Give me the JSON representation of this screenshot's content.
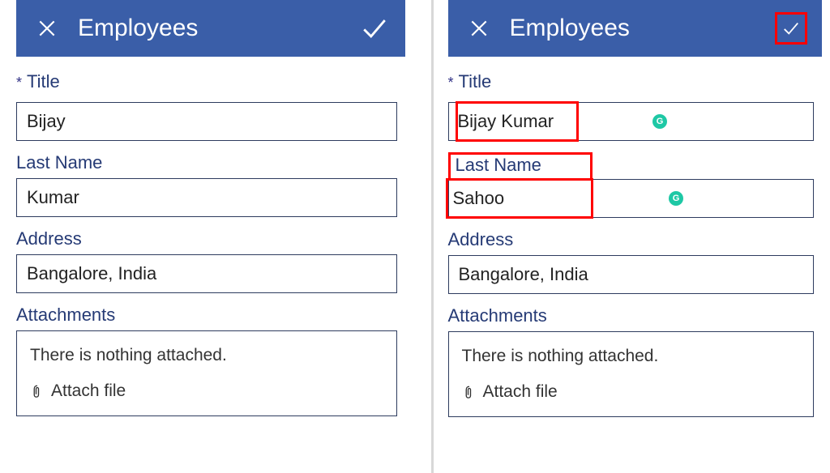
{
  "left": {
    "header": {
      "title": "Employees"
    },
    "fields": {
      "title_label": "Title",
      "title_value": "Bijay",
      "lastname_label": "Last Name",
      "lastname_value": "Kumar",
      "address_label": "Address",
      "address_value": "Bangalore, India",
      "attachments_label": "Attachments",
      "attachments_empty": "There is nothing attached.",
      "attach_link": "Attach file"
    },
    "required_mark": "*"
  },
  "right": {
    "header": {
      "title": "Employees"
    },
    "fields": {
      "title_label": "Title",
      "title_value": "Bijay Kumar",
      "lastname_label": "Last Name",
      "lastname_value": "Sahoo",
      "address_label": "Address",
      "address_value": "Bangalore, India",
      "attachments_label": "Attachments",
      "attachments_empty": "There is nothing attached.",
      "attach_link": "Attach file"
    },
    "required_mark": "*",
    "grammarly": "G"
  }
}
